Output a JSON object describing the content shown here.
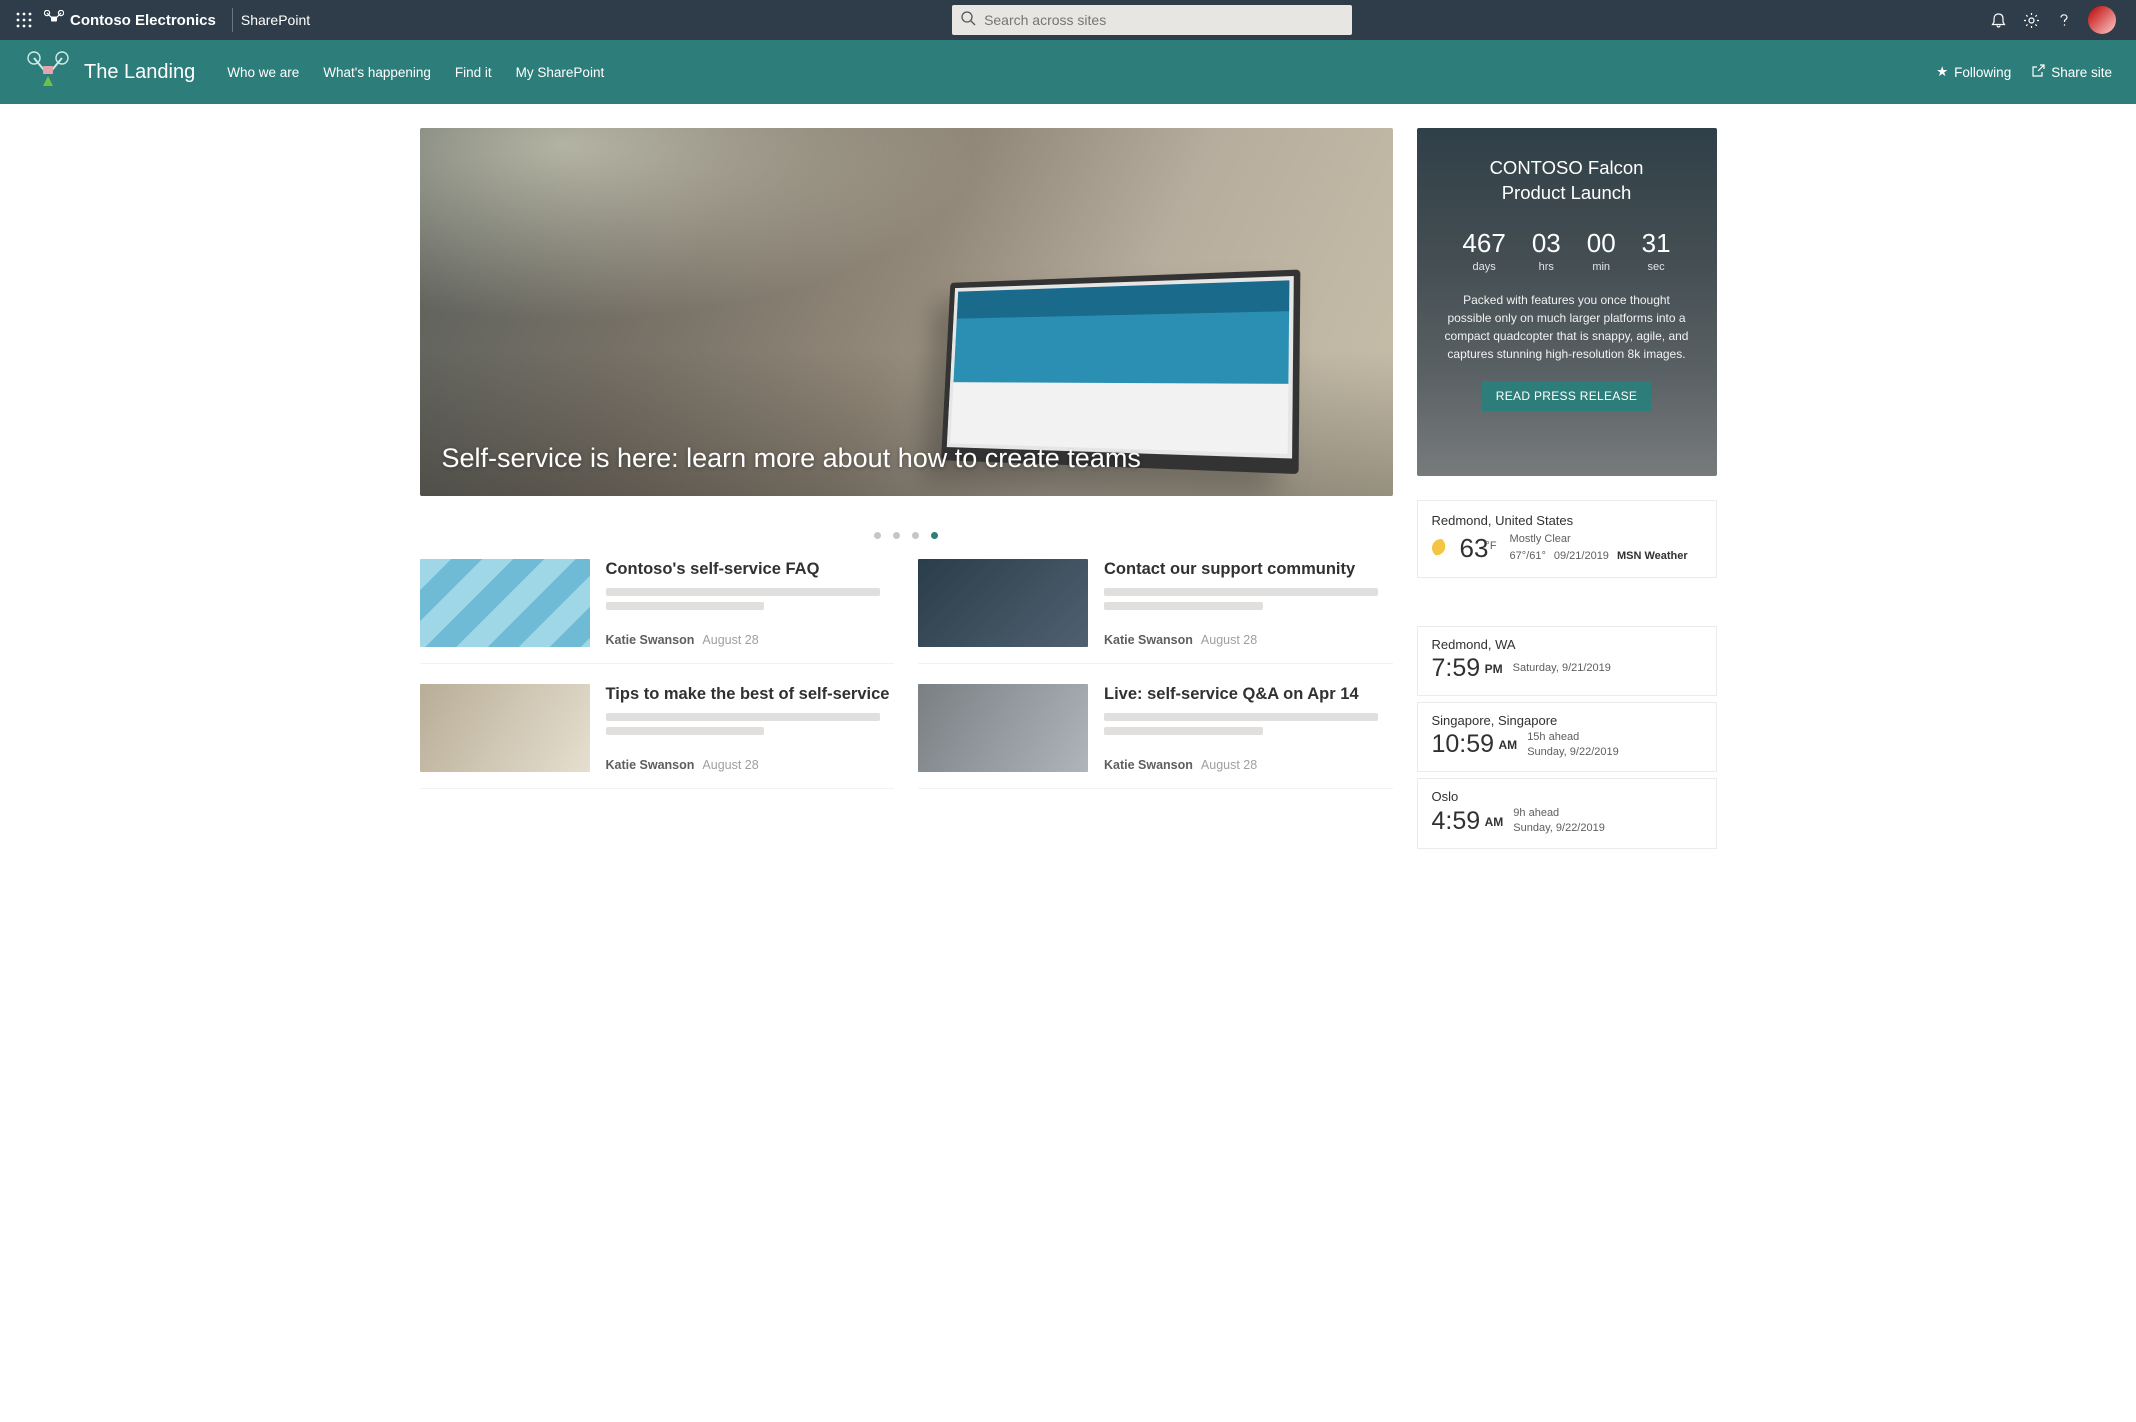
{
  "topbar": {
    "org": "Contoso Electronics",
    "app": "SharePoint",
    "search_placeholder": "Search across sites"
  },
  "site": {
    "title": "The Landing",
    "nav": [
      "Who we are",
      "What's happening",
      "Find it",
      "My SharePoint"
    ],
    "following": "Following",
    "share": "Share site"
  },
  "hero": {
    "title": "Self-service is here: learn more about how to create teams"
  },
  "news": [
    {
      "title": "Contoso's self-service FAQ",
      "author": "Katie Swanson",
      "date": "August 28"
    },
    {
      "title": "Contact our support community",
      "author": "Katie Swanson",
      "date": "August 28"
    },
    {
      "title": "Tips to make the best of self-service",
      "author": "Katie Swanson",
      "date": "August 28"
    },
    {
      "title": "Live: self-service Q&A on Apr 14",
      "author": "Katie Swanson",
      "date": "August 28"
    }
  ],
  "launch": {
    "title_l1": "CONTOSO Falcon",
    "title_l2": "Product Launch",
    "countdown": {
      "days": "467",
      "hrs": "03",
      "min": "00",
      "sec": "31"
    },
    "desc": "Packed with features you once thought possible only on much larger platforms into a compact quadcopter that is snappy, agile, and captures stunning high-resolution 8k images.",
    "button": "READ PRESS RELEASE"
  },
  "weather": {
    "location": "Redmond, United States",
    "temp": "63",
    "unit": "°F",
    "condition": "Mostly Clear",
    "hilo": "67°/61°",
    "date": "09/21/2019",
    "source": "MSN Weather"
  },
  "clocks": [
    {
      "loc": "Redmond, WA",
      "time": "7:59",
      "ampm": "PM",
      "offset": "",
      "date": "Saturday, 9/21/2019"
    },
    {
      "loc": "Singapore, Singapore",
      "time": "10:59",
      "ampm": "AM",
      "offset": "15h ahead",
      "date": "Sunday, 9/22/2019"
    },
    {
      "loc": "Oslo",
      "time": "4:59",
      "ampm": "AM",
      "offset": "9h ahead",
      "date": "Sunday, 9/22/2019"
    }
  ],
  "labels": {
    "days": "days",
    "hrs": "hrs",
    "min": "min",
    "sec": "sec"
  }
}
